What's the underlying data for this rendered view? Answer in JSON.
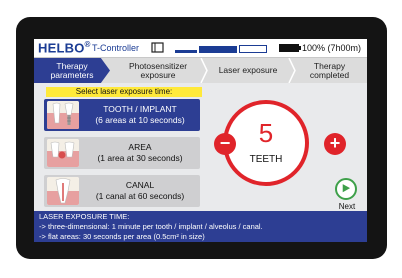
{
  "header": {
    "brand": "HELBO",
    "brand_mark": "®",
    "controller": "T-Controller",
    "battery_text": "100% (7h00m)"
  },
  "steps": [
    {
      "line1": "Therapy",
      "line2": "parameters",
      "active": true
    },
    {
      "line1": "Photosensitizer",
      "line2": "exposure",
      "active": false
    },
    {
      "line1": "Laser exposure",
      "line2": "",
      "active": false
    },
    {
      "line1": "Therapy",
      "line2": "completed",
      "active": false
    }
  ],
  "prompt": "Select laser exposure time:",
  "options": [
    {
      "title": "TOOTH / IMPLANT",
      "detail": "(6 areas at 10 seconds)",
      "icon": "tooth-implant-icon",
      "selected": true
    },
    {
      "title": "AREA",
      "detail": "(1 area at 30 seconds)",
      "icon": "gum-area-icon",
      "selected": false
    },
    {
      "title": "CANAL",
      "detail": "(1 canal at 60 seconds)",
      "icon": "root-canal-icon",
      "selected": false
    }
  ],
  "counter": {
    "value": "5",
    "unit": "TEETH"
  },
  "buttons": {
    "minus": "−",
    "plus": "+",
    "next": "Next"
  },
  "info": {
    "title": "LASER EXPOSURE TIME:",
    "line1": "-> three-dimensional: 1 minute per tooth / implant / alveolus / canal.",
    "line2": "-> flat areas: 30 seconds per area (0.5cm² in size)"
  },
  "colors": {
    "primary": "#2d3e93",
    "accent": "#e0242a",
    "highlight": "#ffe93a",
    "go": "#3ea04a"
  }
}
